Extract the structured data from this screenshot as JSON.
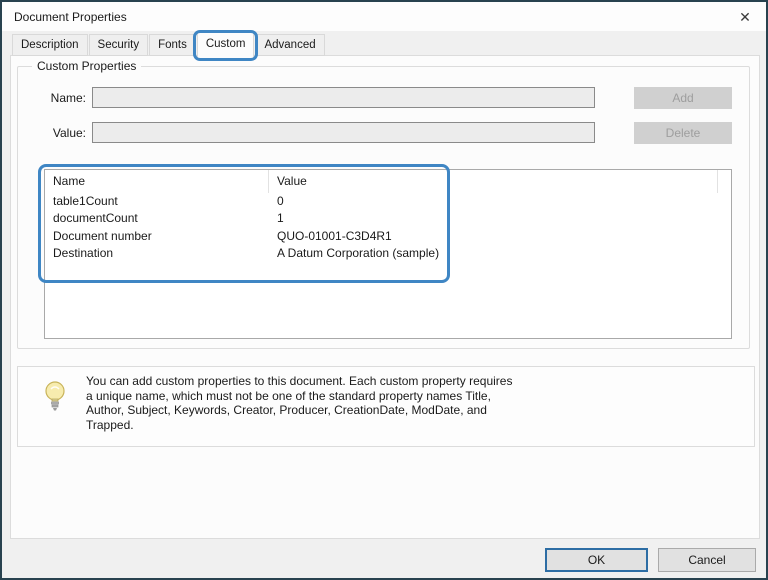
{
  "window": {
    "title": "Document Properties",
    "close_glyph": "✕"
  },
  "tabs": [
    {
      "label": "Description",
      "selected": false
    },
    {
      "label": "Security",
      "selected": false
    },
    {
      "label": "Fonts",
      "selected": false
    },
    {
      "label": "Custom",
      "selected": true
    },
    {
      "label": "Advanced",
      "selected": false
    }
  ],
  "custom_properties": {
    "group_label": "Custom Properties",
    "name_label": "Name:",
    "value_label": "Value:",
    "name_input_value": "",
    "value_input_value": "",
    "add_label": "Add",
    "delete_label": "Delete",
    "table": {
      "columns": [
        "Name",
        "Value"
      ],
      "rows": [
        {
          "name": "table1Count",
          "value": "0"
        },
        {
          "name": "documentCount",
          "value": "1"
        },
        {
          "name": "Document number",
          "value": "QUO-01001-C3D4R1"
        },
        {
          "name": "Destination",
          "value": "A Datum Corporation (sample)"
        }
      ]
    }
  },
  "tip": {
    "lines": [
      "You can add custom properties to this document. Each custom property requires",
      "a unique name, which must not be one of the standard property names Title,",
      "Author, Subject, Keywords, Creator, Producer, CreationDate, ModDate, and",
      "Trapped."
    ]
  },
  "footer": {
    "ok_label": "OK",
    "cancel_label": "Cancel"
  },
  "colors": {
    "annotation_highlight": "#3f86c4",
    "ok_button_border": "#2d6da4",
    "disabled_field_bg": "#ececec",
    "disabled_button_bg": "#d0d0d0"
  }
}
